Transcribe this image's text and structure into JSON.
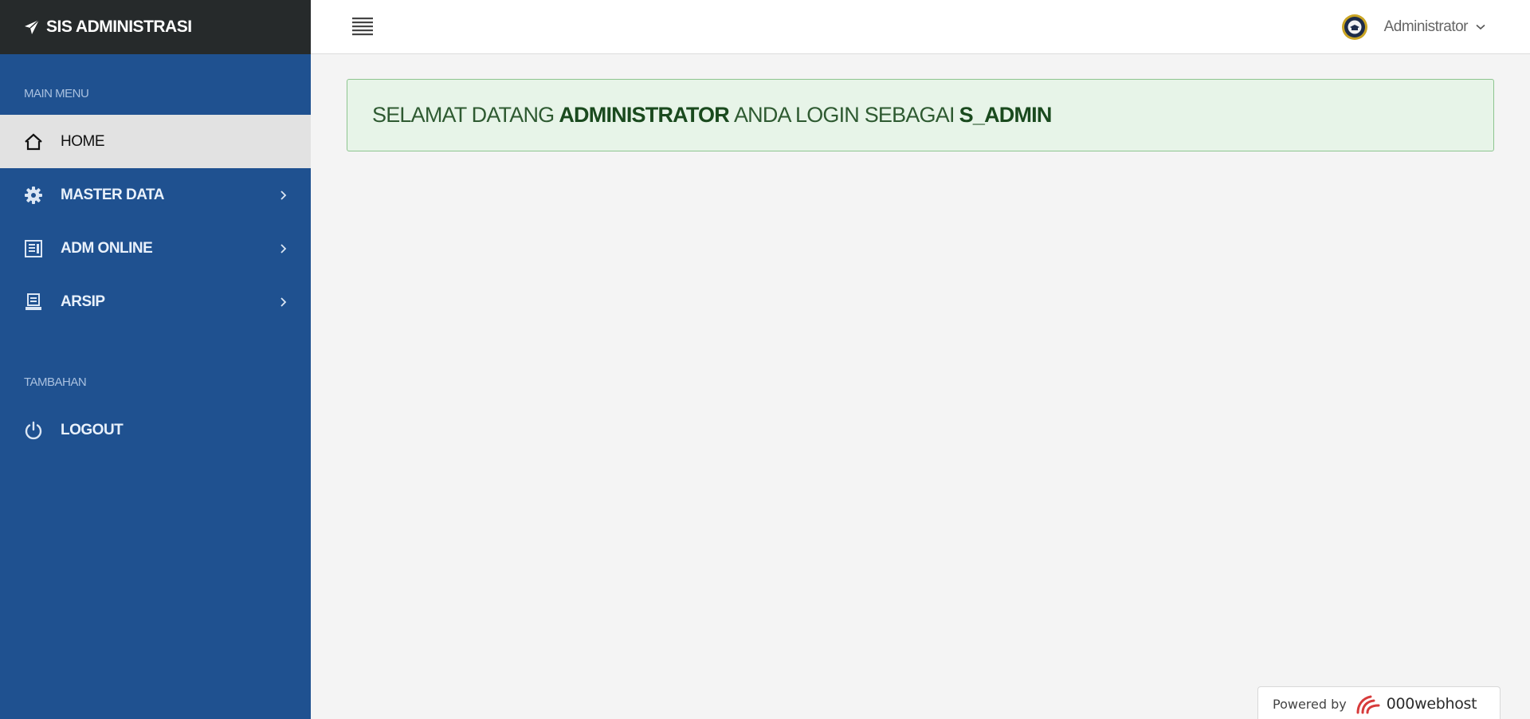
{
  "app": {
    "brand_title": "SIS ADMINISTRASI"
  },
  "sidebar": {
    "main_section_label": "MAIN MENU",
    "extra_section_label": "TAMBAHAN",
    "items": [
      {
        "label": "HOME",
        "icon": "home-icon",
        "active": true
      },
      {
        "label": "MASTER DATA",
        "icon": "gear-icon",
        "has_submenu": true
      },
      {
        "label": "ADM ONLINE",
        "icon": "document-icon",
        "has_submenu": true
      },
      {
        "label": "ARSIP",
        "icon": "archive-icon",
        "has_submenu": true
      }
    ],
    "logout_label": "LOGOUT"
  },
  "header": {
    "user_name": "Administrator"
  },
  "main": {
    "welcome": {
      "prefix": "SELAMAT DATANG",
      "user": "ADMINISTRATOR",
      "middle": "ANDA LOGIN SEBAGAI",
      "role": "S_ADMIN"
    }
  },
  "footer": {
    "powered_by": "Powered by",
    "host_name": "000webhost"
  },
  "colors": {
    "sidebar": "#1f5190",
    "brand_bar": "#262a2b",
    "active_item": "#e2e2e2",
    "welcome_bg": "#e7f4e8",
    "welcome_border": "#8dc58f"
  }
}
